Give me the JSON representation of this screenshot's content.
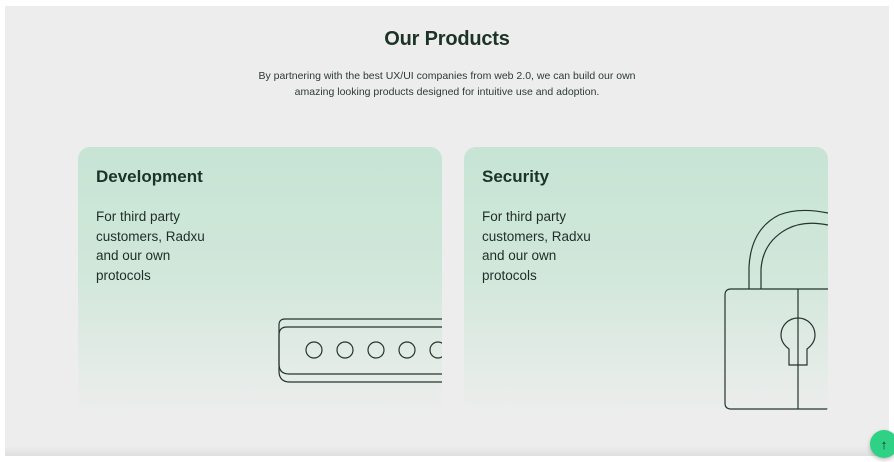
{
  "header": {
    "title": "Our Products",
    "subtitle_line1": "By partnering with the best UX/UI companies from web 2.0, we can build our own",
    "subtitle_line2": "amazing looking products designed for intuitive use and adoption."
  },
  "cards": [
    {
      "title": "Development",
      "description": "For third party customers, Radxu and our own protocols",
      "icon": "password-field-icon"
    },
    {
      "title": "Security",
      "description": "For third party customers, Radxu and our own protocols",
      "icon": "padlock-icon"
    }
  ],
  "scroll_top": {
    "icon": "arrow-up-icon",
    "glyph": "↑"
  },
  "colors": {
    "page_bg": "#ededed",
    "card_mint": "#c7e4d5",
    "heading": "#1c3328",
    "accent": "#2fd184"
  }
}
